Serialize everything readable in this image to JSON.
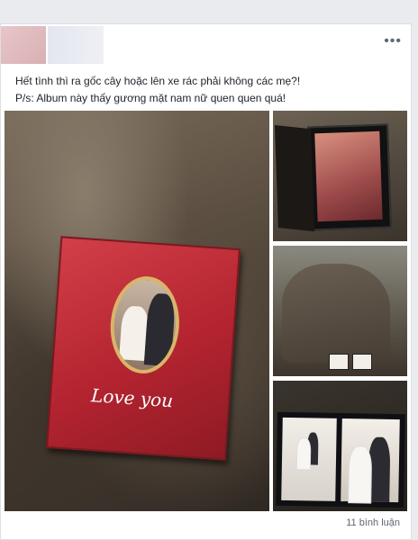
{
  "post": {
    "more_menu": "•••",
    "line1": "Hết tình thì ra gốc cây hoặc lên xe rác phải không các mẹ?!",
    "line2": "P/s: Album này thấy gương mặt nam nữ quen quen quá!"
  },
  "images": {
    "album_cover_text": "Love you"
  },
  "footer": {
    "comment_count": "11 bình luận"
  },
  "icons": {
    "more": "more-options-icon"
  },
  "colors": {
    "album_red": "#c42c36",
    "page_bg": "#e9ebee",
    "text": "#1d2129",
    "muted": "#606770"
  }
}
